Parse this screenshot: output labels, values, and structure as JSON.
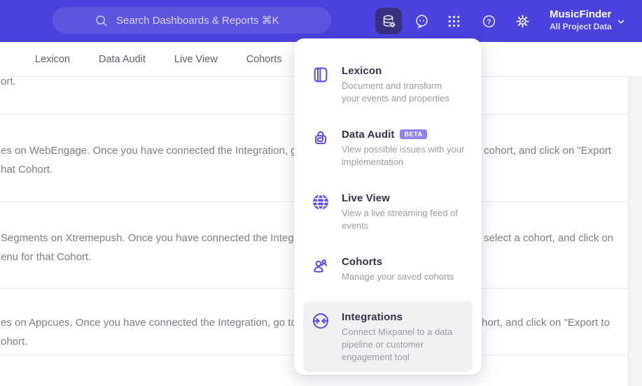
{
  "header": {
    "search": {
      "placeholder": "Search Dashboards & Reports ⌘K"
    },
    "project": {
      "name": "MusicFinder",
      "scope": "All Project Data"
    },
    "icons": [
      "database-gear-icon",
      "chat-face-icon",
      "apps-grid-icon",
      "help-icon",
      "gear-icon",
      "chevron-down-icon"
    ]
  },
  "tabs": {
    "items": [
      "Lexicon",
      "Data Audit",
      "Live View",
      "Cohorts"
    ],
    "active_hidden_tab": "Integrations"
  },
  "menu": {
    "items": [
      {
        "title": "Lexicon",
        "icon": "lexicon-book-icon",
        "description_lines": [
          "Document and transform",
          "your events and properties"
        ]
      },
      {
        "title": "Data Audit",
        "badge": "BETA",
        "icon": "data-audit-lock-icon",
        "description_lines": [
          "View possible issues with your",
          "implementation"
        ]
      },
      {
        "title": "Live View",
        "icon": "live-view-globe-icon",
        "description_lines": [
          "View a live streaming feed of",
          "events"
        ]
      },
      {
        "title": "Cohorts",
        "icon": "cohorts-people-icon",
        "description_lines": [
          "Manage your saved cohorts"
        ]
      },
      {
        "title": "Integrations",
        "icon": "integrations-sync-icon",
        "highlighted": true,
        "description_lines": [
          "Connect Mixpanel to a data",
          "pipeline or customer",
          "engagement tool"
        ]
      }
    ]
  },
  "content": {
    "rows": [
      {
        "l1": "ort.",
        "r1": "",
        "l2": ""
      },
      {
        "l1": "es on WebEngage. Once you have connected the Integration, go to the",
        "r1": "cohort, and click on \"Export",
        "l2": "hat Cohort."
      },
      {
        "l1": "Segments on Xtremepush. Once you have connected the Integration,",
        "r1": "select a cohort, and click on",
        "l2": "enu for that Cohort."
      },
      {
        "l1": "es on Appcues. Once you have connected the Integration, go to the M",
        "r1": "hort, and click on \"Export to",
        "l2": "ohort."
      }
    ]
  },
  "colors": {
    "header_purple": "#4b42dd",
    "accent": "#5b4ee6",
    "active_button_bg": "#39307f",
    "badge_bg": "#9283ea",
    "highlight_bg": "#f1f1f3"
  }
}
